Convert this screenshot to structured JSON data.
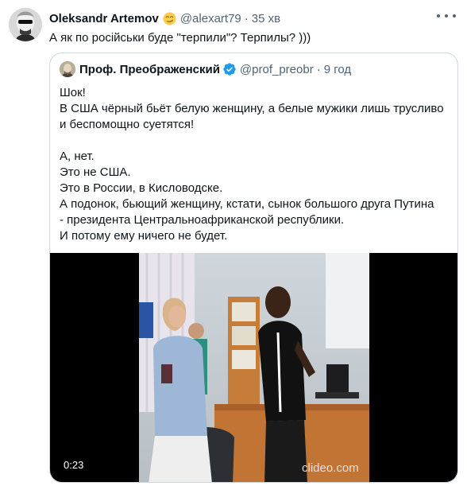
{
  "tweet": {
    "author_name": "Oleksandr Artemov",
    "emoji_icon": "smirking-face",
    "handle": "@alexart79",
    "separator": "·",
    "time": "35 хв",
    "text": "А як по російськи буде \"терпили\"? Терпилы? )))",
    "more_icon": "ellipsis-horizontal"
  },
  "quoted": {
    "author_name": "Проф. Преображенский",
    "verified_icon": "verified-badge",
    "handle": "@prof_preobr",
    "separator": "·",
    "time": "9 год",
    "paragraph1": [
      "Шок!",
      "В США чёрный бьёт белую женщину, а белые мужики лишь трусливо",
      "и беспомощно суетятся!"
    ],
    "paragraph2": [
      "А, нет.",
      "Это не США.",
      "Это в России, в Кисловодске.",
      "А подонок, бьющий женщину, кстати, сынок большого друга Путина",
      "- президента Центральноафриканской республики.",
      "И потому ему ничего не будет."
    ],
    "video": {
      "duration": "0:23",
      "watermark": "clideo.com"
    }
  },
  "colors": {
    "text": "#0f1419",
    "secondary": "#536471",
    "border": "#cfd9de",
    "verified": "#1d9bf0"
  }
}
